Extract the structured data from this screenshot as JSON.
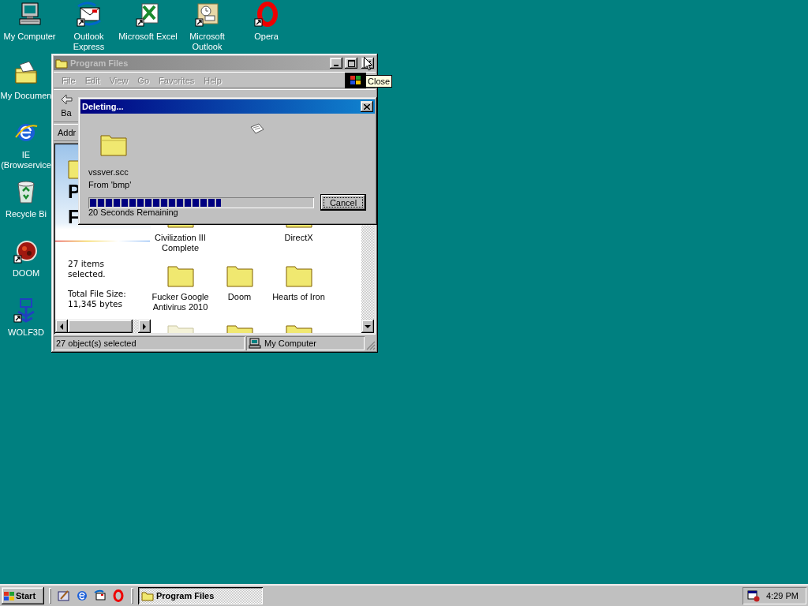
{
  "desktop_icons": [
    {
      "kind": "computer",
      "label": "My Computer",
      "shortcut": false
    },
    {
      "kind": "mail",
      "label": "Outlook Express",
      "shortcut": true
    },
    {
      "kind": "spreadsheet",
      "label": "Microsoft Excel",
      "shortcut": true
    },
    {
      "kind": "calendar",
      "label": "Microsoft Outlook",
      "shortcut": true
    },
    {
      "kind": "ring",
      "label": "Opera",
      "shortcut": true
    },
    {
      "kind": "documents",
      "label": "My Documen",
      "shortcut": false
    },
    {
      "kind": "browser",
      "label": "IE (Browservice",
      "shortcut": false
    },
    {
      "kind": "recycle",
      "label": "Recycle Bi",
      "shortcut": false
    },
    {
      "kind": "disc",
      "label": "DOOM",
      "shortcut": true
    },
    {
      "kind": "emblem",
      "label": "WOLF3D",
      "shortcut": true
    }
  ],
  "explorer": {
    "title": "Program Files",
    "active": false,
    "menu": [
      {
        "label": "File",
        "disabled": true
      },
      {
        "label": "Edit",
        "disabled": true
      },
      {
        "label": "View",
        "disabled": true
      },
      {
        "label": "Go",
        "disabled": true
      },
      {
        "label": "Favorites",
        "disabled": true
      },
      {
        "label": "Help",
        "disabled": true
      }
    ],
    "back_label": "Ba",
    "address_label": "Addr",
    "web_view": {
      "heading": [
        "P",
        "F"
      ],
      "selection": "27 items selected.",
      "size": "Total File Size: 11,345 bytes"
    },
    "folders": [
      {
        "kind": "folder",
        "label": "Civilization III Complete",
        "faded": false
      },
      {
        "kind": "blank"
      },
      {
        "kind": "folder",
        "label": "DirectX",
        "faded": false
      },
      {
        "kind": "folder",
        "label": "Fucker Google Antivirus 2010",
        "faded": false
      },
      {
        "kind": "folder",
        "label": "Doom",
        "faded": false
      },
      {
        "kind": "folder",
        "label": "Hearts of Iron",
        "faded": false
      },
      {
        "kind": "folder",
        "faded": true
      },
      {
        "kind": "folder",
        "faded": false
      },
      {
        "kind": "folder",
        "faded": false
      }
    ],
    "status": [
      {
        "kind": "text",
        "label": "27 object(s) selected"
      },
      {
        "kind": "zone",
        "label": "My Computer"
      }
    ]
  },
  "tooltip": {
    "text": "Close"
  },
  "dialog": {
    "title": "Deleting...",
    "active": true,
    "file": "vssver.scc",
    "source": "From 'bmp'",
    "progress": {
      "level": 0.59
    },
    "remaining": "20 Seconds Remaining",
    "button": "Cancel"
  },
  "taskbar": {
    "start": "Start",
    "tasks": [
      {
        "label": "Program Files",
        "selected": true
      }
    ],
    "clock": "4:29 PM"
  }
}
